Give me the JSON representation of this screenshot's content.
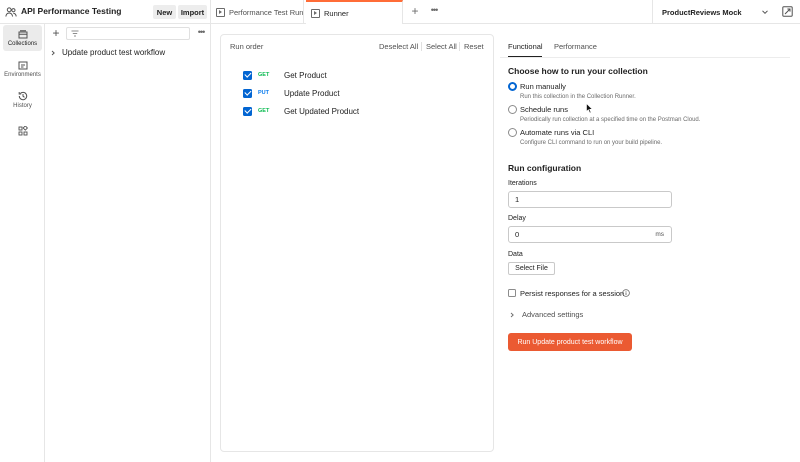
{
  "workspace": {
    "title": "API Performance Testing",
    "new_label": "New",
    "import_label": "Import"
  },
  "tabs": [
    {
      "label": "Performance Test Runner",
      "active": false
    },
    {
      "label": "Runner",
      "active": true
    }
  ],
  "environment": {
    "selected": "ProductReviews Mock"
  },
  "rail": {
    "collections": "Collections",
    "environments": "Environments",
    "history": "History"
  },
  "sidebar": {
    "items": [
      {
        "label": "Update product test workflow"
      }
    ]
  },
  "run_order": {
    "title": "Run order",
    "deselect_all": "Deselect All",
    "select_all": "Select All",
    "reset": "Reset",
    "requests": [
      {
        "method": "GET",
        "name": "Get Product",
        "checked": true,
        "method_color": "#0cbb52"
      },
      {
        "method": "PUT",
        "name": "Update Product",
        "checked": true,
        "method_color": "#097bed"
      },
      {
        "method": "GET",
        "name": "Get Updated Product",
        "checked": true,
        "method_color": "#0cbb52"
      }
    ]
  },
  "config": {
    "tabs": {
      "functional": "Functional",
      "performance": "Performance"
    },
    "run_title": "Choose how to run your collection",
    "options": [
      {
        "label": "Run manually",
        "desc": "Run this collection in the Collection Runner.",
        "selected": true
      },
      {
        "label": "Schedule runs",
        "desc": "Periodically run collection at a specified time on the Postman Cloud.",
        "selected": false
      },
      {
        "label": "Automate runs via CLI",
        "desc": "Configure CLI command to run on your build pipeline.",
        "selected": false
      }
    ],
    "run_config_title": "Run configuration",
    "iterations_label": "Iterations",
    "iterations_value": "1",
    "delay_label": "Delay",
    "delay_value": "0",
    "delay_unit": "ms",
    "data_label": "Data",
    "select_file": "Select File",
    "persist_label": "Persist responses for a session",
    "persist_checked": false,
    "advanced_label": "Advanced settings",
    "run_button": "Run Update product test workflow"
  },
  "colors": {
    "accent": "#ff6c37",
    "run_button": "#eb5a32",
    "checkbox": "#0265d2"
  }
}
